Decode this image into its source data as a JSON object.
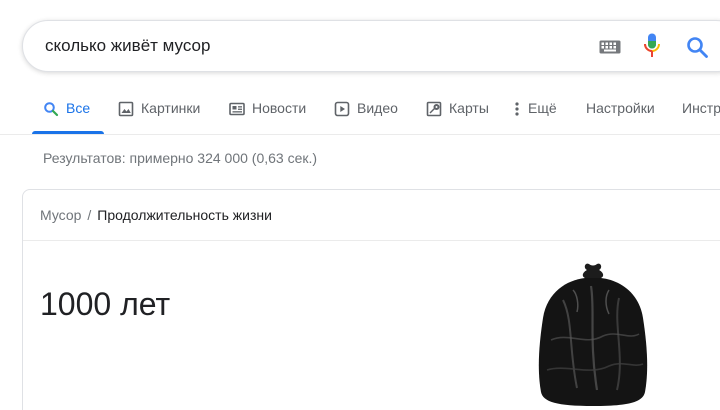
{
  "search": {
    "query": "сколько живёт мусор"
  },
  "tabs": [
    {
      "label": "Все",
      "icon": "search-icon",
      "active": true
    },
    {
      "label": "Картинки",
      "icon": "image-icon",
      "active": false
    },
    {
      "label": "Новости",
      "icon": "news-icon",
      "active": false
    },
    {
      "label": "Видео",
      "icon": "video-icon",
      "active": false
    },
    {
      "label": "Карты",
      "icon": "map-icon",
      "active": false
    },
    {
      "label": "Ещё",
      "icon": "more-vertical-icon",
      "active": false
    },
    {
      "label": "Настройки",
      "icon": "",
      "active": false
    },
    {
      "label": "Инстр",
      "icon": "",
      "active": false
    }
  ],
  "results": {
    "stats": "Результатов: примерно 324 000 (0,63 сек.)"
  },
  "card": {
    "breadcrumb": {
      "parent": "Мусор",
      "separator": "/",
      "current": "Продолжительность жизни"
    },
    "answer": "1000 лет",
    "image_subject": "black garbage bag"
  },
  "colors": {
    "accent": "#1a73e8",
    "text": "#202124",
    "secondary_text": "#5f6368",
    "muted_text": "#70757a",
    "border": "#dfe1e5"
  }
}
